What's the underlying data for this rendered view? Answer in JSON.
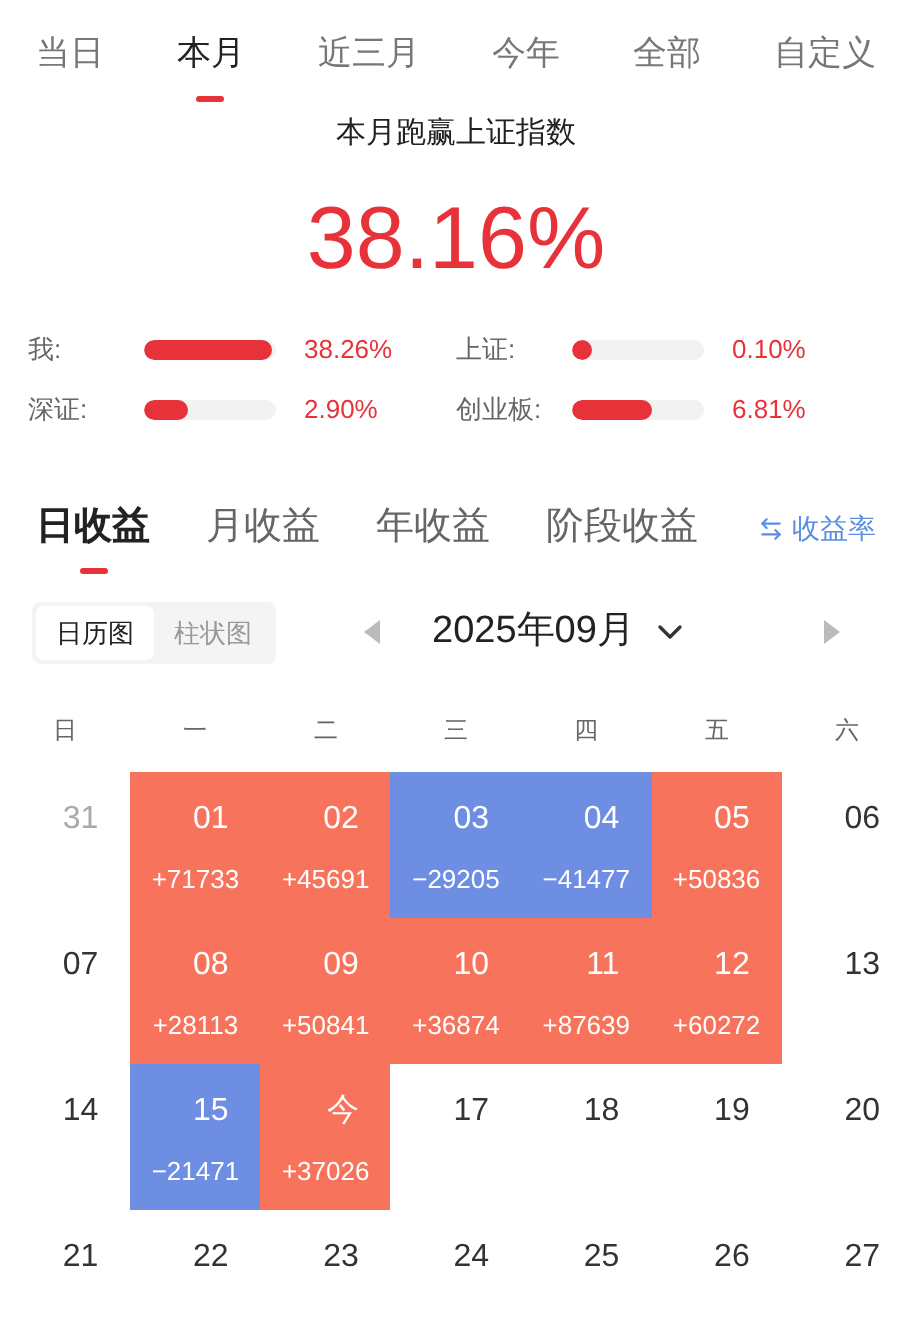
{
  "period_tabs": [
    {
      "label": "当日",
      "selected": false
    },
    {
      "label": "本月",
      "selected": true
    },
    {
      "label": "近三月",
      "selected": false
    },
    {
      "label": "今年",
      "selected": false
    },
    {
      "label": "全部",
      "selected": false
    },
    {
      "label": "自定义",
      "selected": false
    }
  ],
  "summary": {
    "title": "本月跑赢上证指数",
    "value": "38.16%"
  },
  "comparisons": [
    {
      "label": "我:",
      "level": 0.97,
      "reading": "38.26%"
    },
    {
      "label": "上证:",
      "level": 0.06,
      "reading": "0.10%"
    },
    {
      "label": "深证:",
      "level": 0.34,
      "reading": "2.90%"
    },
    {
      "label": "创业板:",
      "level": 0.6,
      "reading": "6.81%"
    }
  ],
  "earning_tabs": [
    {
      "label": "日收益",
      "selected": true
    },
    {
      "label": "月收益",
      "selected": false
    },
    {
      "label": "年收益",
      "selected": false
    },
    {
      "label": "阶段收益",
      "selected": false
    }
  ],
  "rate_toggle": "收益率",
  "view_toggle": [
    {
      "label": "日历图",
      "selected": true
    },
    {
      "label": "柱状图",
      "selected": false
    }
  ],
  "month": "2025年09月",
  "weekdays": [
    "日",
    "一",
    "二",
    "三",
    "四",
    "五",
    "六"
  ],
  "weeks": [
    [
      {
        "day": "31",
        "kind": "outside"
      },
      {
        "day": "01",
        "kind": "gain",
        "amount": "+71733"
      },
      {
        "day": "02",
        "kind": "gain",
        "amount": "+45691"
      },
      {
        "day": "03",
        "kind": "loss",
        "amount": "−29205"
      },
      {
        "day": "04",
        "kind": "loss",
        "amount": "−41477"
      },
      {
        "day": "05",
        "kind": "gain",
        "amount": "+50836"
      },
      {
        "day": "06",
        "kind": "plain"
      }
    ],
    [
      {
        "day": "07",
        "kind": "plain"
      },
      {
        "day": "08",
        "kind": "gain",
        "amount": "+28113"
      },
      {
        "day": "09",
        "kind": "gain",
        "amount": "+50841"
      },
      {
        "day": "10",
        "kind": "gain",
        "amount": "+36874"
      },
      {
        "day": "11",
        "kind": "gain",
        "amount": "+87639"
      },
      {
        "day": "12",
        "kind": "gain",
        "amount": "+60272"
      },
      {
        "day": "13",
        "kind": "plain"
      }
    ],
    [
      {
        "day": "14",
        "kind": "plain"
      },
      {
        "day": "15",
        "kind": "loss",
        "amount": "−21471"
      },
      {
        "day": "今",
        "kind": "gain",
        "amount": "+37026"
      },
      {
        "day": "17",
        "kind": "plain"
      },
      {
        "day": "18",
        "kind": "plain"
      },
      {
        "day": "19",
        "kind": "plain"
      },
      {
        "day": "20",
        "kind": "plain"
      }
    ],
    [
      {
        "day": "21",
        "kind": "plain"
      },
      {
        "day": "22",
        "kind": "plain"
      },
      {
        "day": "23",
        "kind": "plain"
      },
      {
        "day": "24",
        "kind": "plain"
      },
      {
        "day": "25",
        "kind": "plain"
      },
      {
        "day": "26",
        "kind": "plain"
      },
      {
        "day": "27",
        "kind": "plain"
      }
    ]
  ]
}
